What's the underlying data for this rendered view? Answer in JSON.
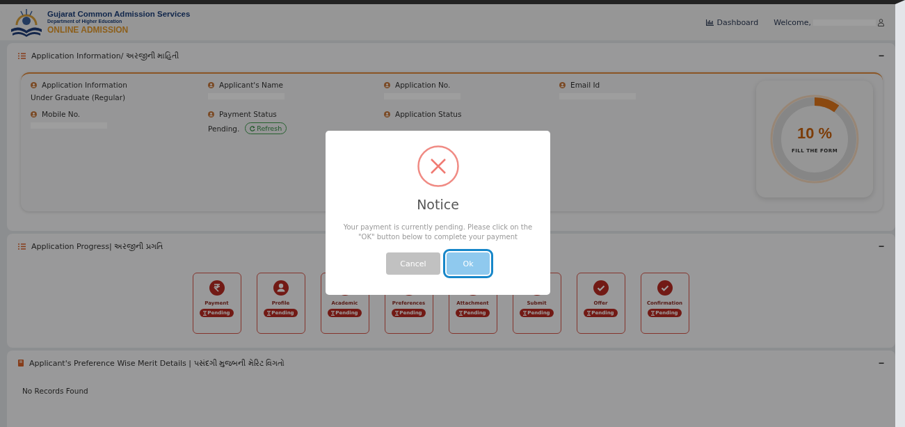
{
  "header": {
    "title": "Gujarat Common Admission Services",
    "subtitle": "Department of Higher Education",
    "brand": "ONLINE ADMISSION",
    "nav": [
      {
        "label": "Dashboard"
      }
    ],
    "welcome": "Welcome,",
    "welcome_redacted": true
  },
  "info_panel": {
    "title": "Application Information/ અરજીની માહિતી",
    "collapse": "−",
    "fields": [
      {
        "label": "Application Information",
        "value": "Under Graduate (Regular)"
      },
      {
        "label": "Applicant's Name",
        "redacted": true
      },
      {
        "label": "Application No.",
        "redacted": true
      },
      {
        "label": "Email Id",
        "redacted": true
      },
      {
        "label": "Mobile No.",
        "redacted": true
      },
      {
        "label": "Payment Status",
        "value": "Pending.",
        "action": "Refresh"
      },
      {
        "label": "Application Status"
      }
    ],
    "progress": {
      "level": 0.1,
      "value": "10 %",
      "caption": "FILL THE FORM"
    }
  },
  "progress_panel": {
    "title": "Application Progress| અરજીની પ્રગતિ",
    "collapse": "−",
    "steps": [
      {
        "name": "Payment",
        "kind": "payment",
        "status": "Pending"
      },
      {
        "name": "Profile",
        "kind": "profile",
        "status": "Pending"
      },
      {
        "name": "Academic",
        "kind": "task",
        "status": "Pending"
      },
      {
        "name": "Preferences",
        "kind": "task",
        "status": "Pending"
      },
      {
        "name": "Attachment",
        "kind": "task",
        "status": "Pending"
      },
      {
        "name": "Submit",
        "kind": "task",
        "status": "Pending"
      },
      {
        "name": "Offer",
        "kind": "task",
        "status": "Pending"
      },
      {
        "name": "Confirmation",
        "kind": "task",
        "status": "Pending"
      }
    ]
  },
  "merit_panel": {
    "title": "Applicant's Preference Wise Merit Details | પસંદગી મુજબની મેરિટ વિગતો",
    "collapse": "−",
    "empty": "No Records Found"
  },
  "dialog": {
    "title": "Notice",
    "message": "Your payment is currently pending. Please click on the \"OK\" button below to complete your payment",
    "buttons": [
      {
        "label": "Cancel",
        "kind": "cancel",
        "focused": false
      },
      {
        "label": "Ok",
        "kind": "confirm",
        "focused": true
      }
    ]
  }
}
